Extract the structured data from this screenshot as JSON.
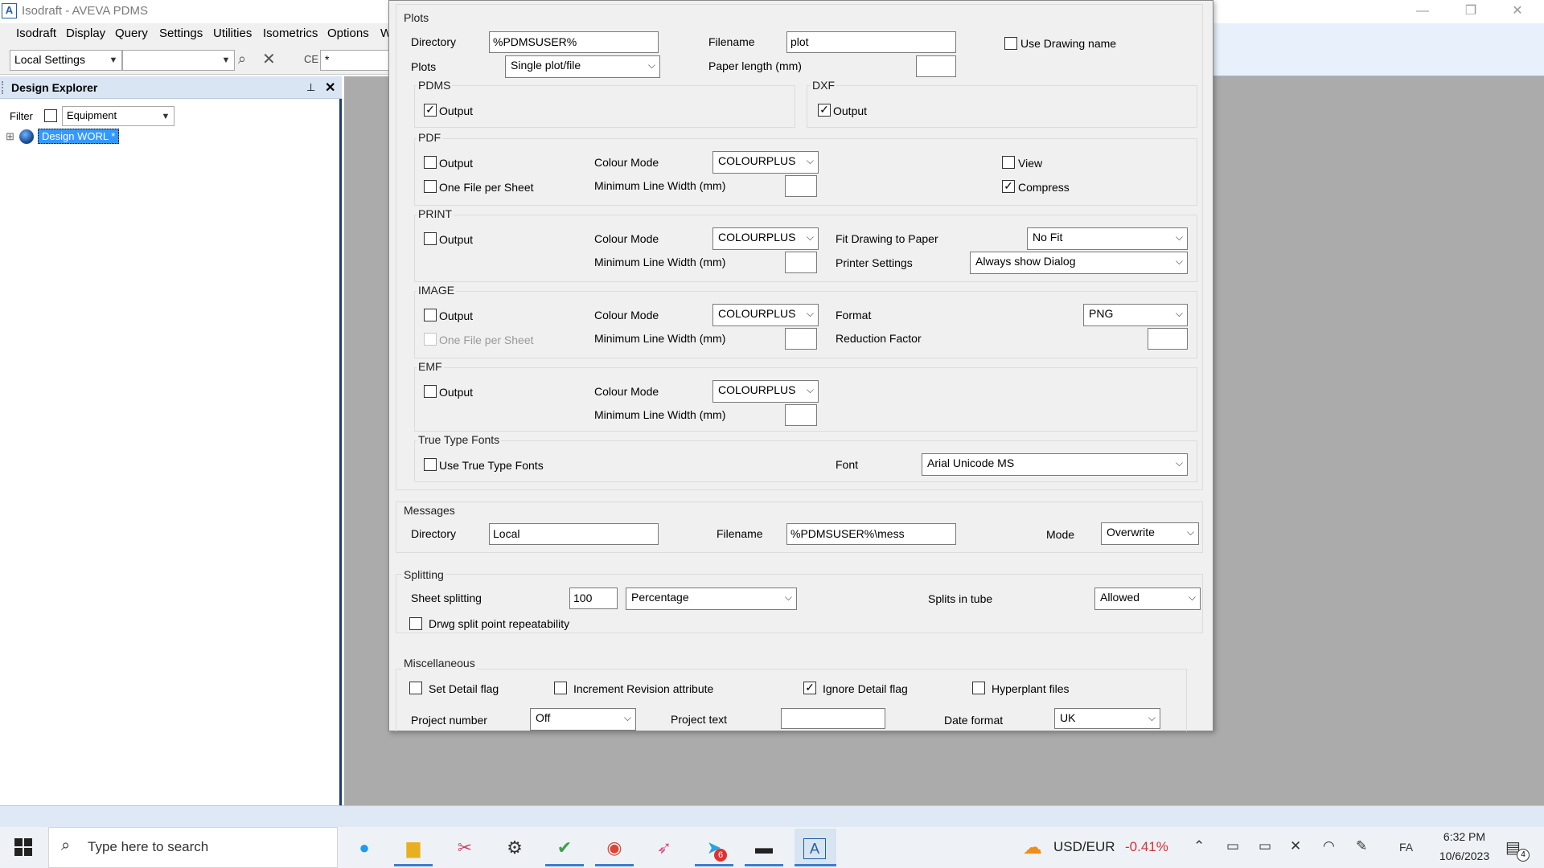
{
  "window": {
    "app_icon": "A",
    "title": "Isodraft - AVEVA PDMS",
    "controls": {
      "minimize": "—",
      "restore": "❐",
      "close": "✕"
    }
  },
  "menubar": [
    "Isodraft",
    "Display",
    "Query",
    "Settings",
    "Utilities",
    "Isometrics",
    "Options",
    "W"
  ],
  "toolbar": {
    "settings_value": "Local Settings",
    "second_combo_value": "",
    "ce_label": "CE",
    "ce_value": "*"
  },
  "explorer": {
    "title": "Design Explorer",
    "filter_label": "Filter",
    "filter_value": "Equipment",
    "tree_expander": "⊞",
    "tree_root": "Design WORL *"
  },
  "dialog": {
    "plots": {
      "title": "Plots",
      "directory_label": "Directory",
      "directory_value": "%PDMSUSER%",
      "filename_label": "Filename",
      "filename_value": "plot",
      "use_drawing_name_label": "Use Drawing name",
      "use_drawing_name_checked": false,
      "plots_label": "Plots",
      "plots_value": "Single plot/file",
      "paper_length_label": "Paper length (mm)",
      "paper_length_value": "",
      "pdms": {
        "title": "PDMS",
        "output_label": "Output",
        "output_checked": true
      },
      "dxf": {
        "title": "DXF",
        "output_label": "Output",
        "output_checked": true
      },
      "pdf": {
        "title": "PDF",
        "output_label": "Output",
        "output_checked": false,
        "one_file_label": "One File per Sheet",
        "one_file_checked": false,
        "colour_mode_label": "Colour Mode",
        "colour_mode_value": "COLOURPLUS",
        "min_line_label": "Minimum Line Width (mm)",
        "min_line_value": "",
        "view_label": "View",
        "view_checked": false,
        "compress_label": "Compress",
        "compress_checked": true
      },
      "print": {
        "title": "PRINT",
        "output_label": "Output",
        "output_checked": false,
        "colour_mode_label": "Colour Mode",
        "colour_mode_value": "COLOURPLUS",
        "min_line_label": "Minimum Line Width (mm)",
        "min_line_value": "",
        "fit_label": "Fit Drawing to Paper",
        "fit_value": "No Fit",
        "printer_label": "Printer Settings",
        "printer_value": "Always show Dialog"
      },
      "image": {
        "title": "IMAGE",
        "output_label": "Output",
        "output_checked": false,
        "one_file_label": "One File per Sheet",
        "one_file_checked": false,
        "colour_mode_label": "Colour Mode",
        "colour_mode_value": "COLOURPLUS",
        "min_line_label": "Minimum Line Width (mm)",
        "min_line_value": "",
        "format_label": "Format",
        "format_value": "PNG",
        "reduction_label": "Reduction Factor",
        "reduction_value": ""
      },
      "emf": {
        "title": "EMF",
        "output_label": "Output",
        "output_checked": false,
        "colour_mode_label": "Colour Mode",
        "colour_mode_value": "COLOURPLUS",
        "min_line_label": "Minimum Line Width (mm)",
        "min_line_value": ""
      },
      "ttf": {
        "title": "True Type Fonts",
        "use_label": "Use True Type Fonts",
        "use_checked": false,
        "font_label": "Font",
        "font_value": "Arial Unicode MS"
      }
    },
    "messages": {
      "title": "Messages",
      "directory_label": "Directory",
      "directory_value": "Local",
      "filename_label": "Filename",
      "filename_value": "%PDMSUSER%\\mess",
      "mode_label": "Mode",
      "mode_value": "Overwrite"
    },
    "splitting": {
      "title": "Splitting",
      "sheet_label": "Sheet splitting",
      "sheet_value": "100",
      "sheet_unit_value": "Percentage",
      "tube_label": "Splits in tube",
      "tube_value": "Allowed",
      "repeat_label": "Drwg split point repeatability",
      "repeat_checked": false
    },
    "misc": {
      "title": "Miscellaneous",
      "set_detail_label": "Set Detail flag",
      "set_detail_checked": false,
      "increment_label": "Increment Revision attribute",
      "increment_checked": false,
      "ignore_label": "Ignore Detail flag",
      "ignore_checked": true,
      "hyperplant_label": "Hyperplant files",
      "hyperplant_checked": false,
      "project_number_label": "Project number",
      "project_number_value": "Off",
      "project_text_label": "Project text",
      "project_text_value": "",
      "date_format_label": "Date format",
      "date_format_value": "UK"
    }
  },
  "taskbar": {
    "search_placeholder": "Type here to search",
    "badge_telegram": "6",
    "ticker_name": "USD/EUR",
    "ticker_change": "-0.41%",
    "ticker_change_color": "#d13438",
    "lang": "FA",
    "time": "6:32 PM",
    "date": "10/6/2023",
    "notification_count": "4"
  },
  "colors": {
    "accent": "#1f5fa8",
    "selection": "#3399ff",
    "workspace": "#ababab"
  }
}
